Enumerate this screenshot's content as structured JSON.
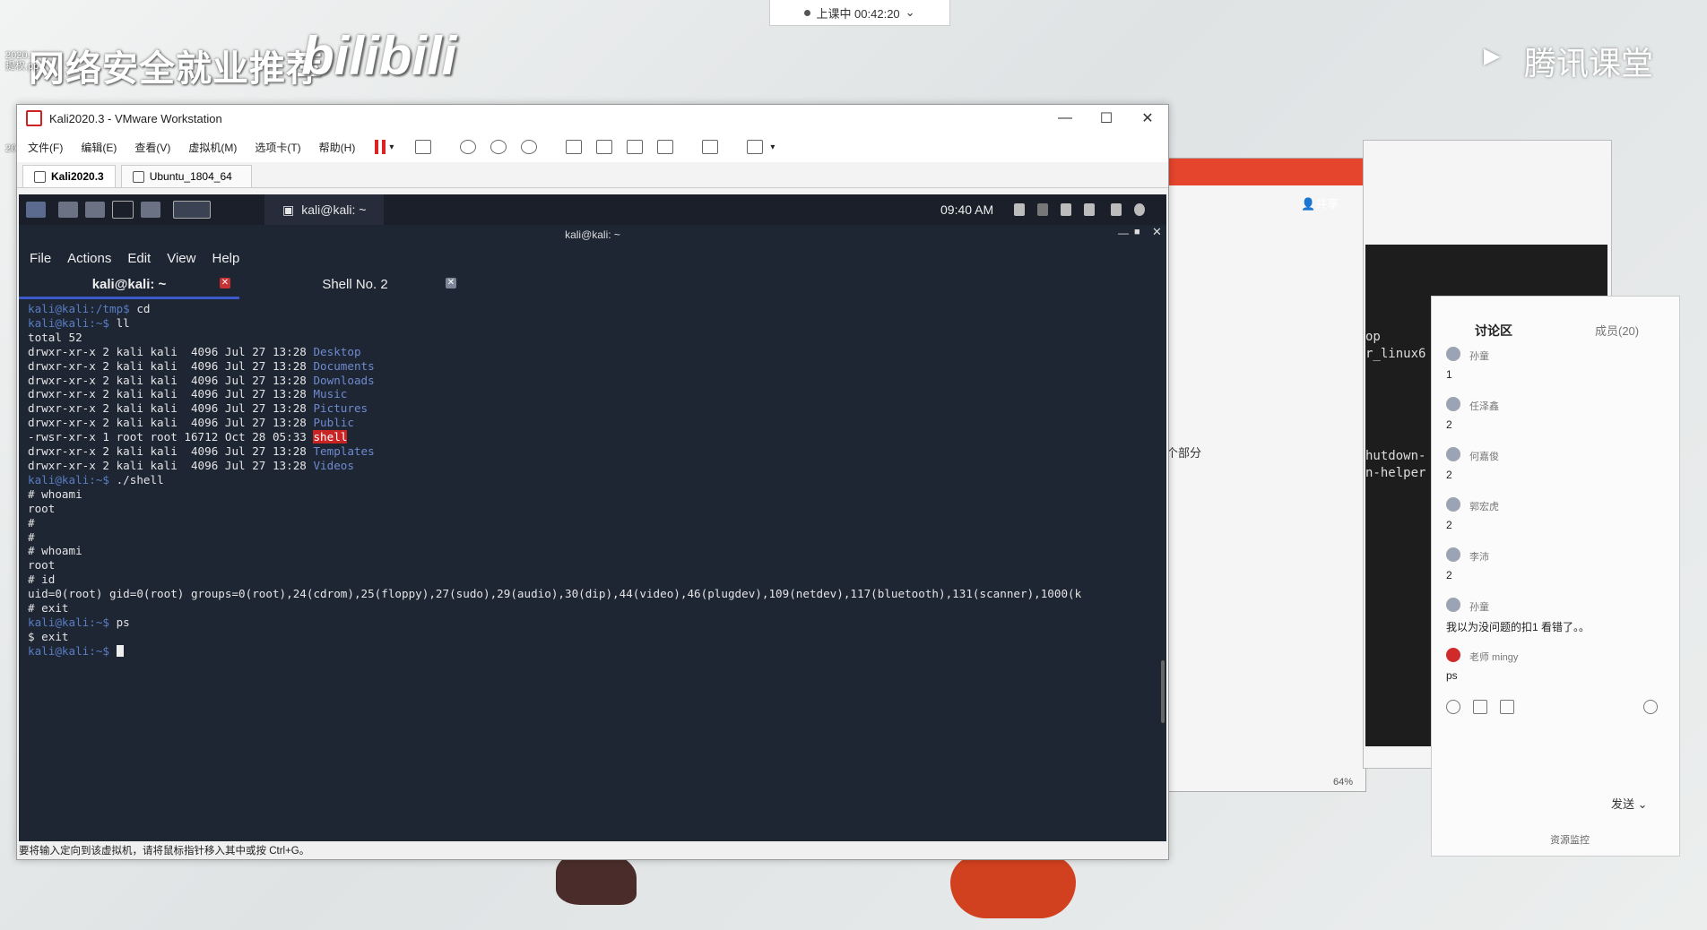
{
  "desktop": {
    "banner_text": "网络安全就业推荐",
    "bili_logo": "bilibili",
    "tencent_logo": "腾讯课堂",
    "class_timer": "上课中 00:42:20",
    "desktop_icon_1": "2020.",
    "desktop_icon_1b": "提权.pp",
    "desktop_icon_2": "20"
  },
  "vmware": {
    "title": "Kali2020.3 - VMware Workstation",
    "menu": [
      "文件(F)",
      "编辑(E)",
      "查看(V)",
      "虚拟机(M)",
      "选项卡(T)",
      "帮助(H)"
    ],
    "tabs": [
      "Kali2020.3",
      "Ubuntu_1804_64"
    ],
    "status": "要将输入定向到该虚拟机，请将鼠标指针移入其中或按 Ctrl+G。"
  },
  "kali": {
    "task_label": "kali@kali: ~",
    "clock": "09:40 AM",
    "window_title": "kali@kali: ~",
    "menu": [
      "File",
      "Actions",
      "Edit",
      "View",
      "Help"
    ],
    "tabs": [
      "kali@kali: ~",
      "Shell No. 2"
    ],
    "tab_close_glyph": "✕",
    "terminal": [
      {
        "p": "kali@kali:/tmp$",
        "t": " cd"
      },
      {
        "p": "kali@kali:~$",
        "t": " ll"
      },
      {
        "t": "total 52"
      },
      {
        "t": "drwxr-xr-x 2 kali kali  4096 Jul 27 13:28 ",
        "d": "Desktop"
      },
      {
        "t": "drwxr-xr-x 2 kali kali  4096 Jul 27 13:28 ",
        "d": "Documents"
      },
      {
        "t": "drwxr-xr-x 2 kali kali  4096 Jul 27 13:28 ",
        "d": "Downloads"
      },
      {
        "t": "drwxr-xr-x 2 kali kali  4096 Jul 27 13:28 ",
        "d": "Music"
      },
      {
        "t": "drwxr-xr-x 2 kali kali  4096 Jul 27 13:28 ",
        "d": "Pictures"
      },
      {
        "t": "drwxr-xr-x 2 kali kali  4096 Jul 27 13:28 ",
        "d": "Public"
      },
      {
        "t": "-rwsr-xr-x 1 root root 16712 Oct 28 05:33 ",
        "s": "shell"
      },
      {
        "t": "drwxr-xr-x 2 kali kali  4096 Jul 27 13:28 ",
        "d": "Templates"
      },
      {
        "t": "drwxr-xr-x 2 kali kali  4096 Jul 27 13:28 ",
        "d": "Videos"
      },
      {
        "p": "kali@kali:~$",
        "t": " ./shell"
      },
      {
        "t": "# whoami"
      },
      {
        "t": "root"
      },
      {
        "t": "#"
      },
      {
        "t": "#"
      },
      {
        "t": "# whoami"
      },
      {
        "t": "root"
      },
      {
        "t": "# id"
      },
      {
        "t": "uid=0(root) gid=0(root) groups=0(root),24(cdrom),25(floppy),27(sudo),29(audio),30(dip),44(video),46(plugdev),109(netdev),117(bluetooth),131(scanner),1000(k"
      },
      {
        "t": "# exit"
      },
      {
        "p": "kali@kali:~$",
        "t": " ps"
      },
      {
        "t": "$ exit"
      },
      {
        "p": "kali@kali:~$",
        "t": " ",
        "c": true
      }
    ]
  },
  "pdf_window": {
    "share": "共享",
    "text": "个部分",
    "zoom": "64%"
  },
  "term2": {
    "lines": [
      "op",
      "r_linux6",
      "",
      "",
      "",
      "",
      "",
      "hutdown-",
      "n-helper"
    ]
  },
  "chat": {
    "tab_discuss": "讨论区",
    "tab_members": "成员(20)",
    "messages": [
      {
        "name": "孙童",
        "text": "1"
      },
      {
        "name": "任泽鑫",
        "text": "2"
      },
      {
        "name": "何嘉俊",
        "text": "2"
      },
      {
        "name": "郭宏虎",
        "text": "2"
      },
      {
        "name": "李沛",
        "text": "2"
      },
      {
        "name": "孙童",
        "text": "我以为没问题的扣1  看错了。。"
      },
      {
        "name": "老师 mingy",
        "text": "ps"
      }
    ],
    "send": "发送",
    "monitor": "资源监控"
  }
}
